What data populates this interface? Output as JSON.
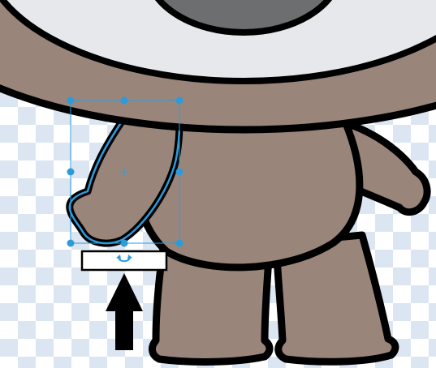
{
  "editor": {
    "tool_hint": "",
    "colors": {
      "checker_light": "#ffffff",
      "checker_dark": "#dce6f2",
      "body_fill": "#9a857b",
      "outline": "#000000",
      "head_fill": "#e6e8eb",
      "eye_fill": "#6d6e70",
      "selection": "#2d9bdb"
    },
    "icons": {
      "rotate": "rotate-icon",
      "pointer_arrow": "arrow-up-icon"
    }
  }
}
